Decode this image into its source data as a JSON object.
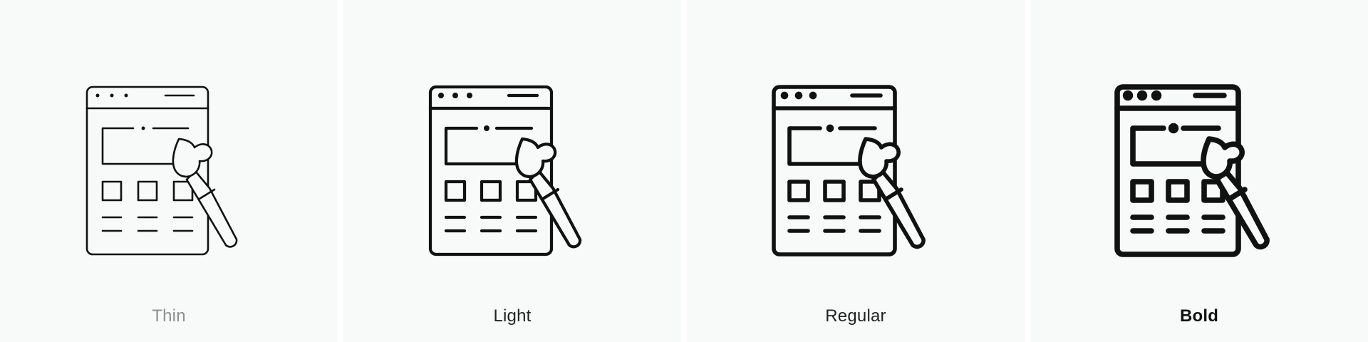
{
  "variants": [
    {
      "label": "Thin",
      "stroke": 2.6,
      "color": "#111111"
    },
    {
      "label": "Light",
      "stroke": 4.2,
      "color": "#111111"
    },
    {
      "label": "Regular",
      "stroke": 5.6,
      "color": "#111111"
    },
    {
      "label": "Bold",
      "stroke": 7.6,
      "color": "#111111"
    }
  ],
  "icon_name": "web-design-brush-icon"
}
